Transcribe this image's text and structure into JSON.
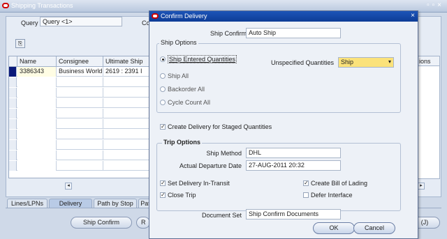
{
  "bg_window": {
    "title": "Shipping Transactions",
    "query_label": "Query",
    "query_value": "Query <1>",
    "co_text": "Co",
    "grid": {
      "headers": [
        "Name",
        "Consignee",
        "Ultimate Ship"
      ],
      "rows": [
        [
          "3386343",
          "Business World",
          "2619 : 2391 I"
        ]
      ],
      "right_header": "ions"
    },
    "tabs": [
      "Lines/LPNs",
      "Delivery",
      "Path by Stop",
      "Pat"
    ],
    "buttons": {
      "ship_confirm": "Ship Confirm",
      "r_button": "R",
      "j_button": "(J)"
    }
  },
  "dialog": {
    "title": "Confirm Delivery",
    "ship_confirm_rule_label": "Ship Confirm Rule",
    "ship_confirm_rule_value": "Auto Ship",
    "ship_options": {
      "title": "Ship Options",
      "radios": [
        {
          "label": "Ship Entered Quantities",
          "selected": true
        },
        {
          "label": "Ship All",
          "selected": false
        },
        {
          "label": "Backorder All",
          "selected": false
        },
        {
          "label": "Cycle Count All",
          "selected": false
        }
      ],
      "unspecified_label": "Unspecified Quantities",
      "unspecified_value": "Ship"
    },
    "create_delivery_staged": {
      "label": "Create Delivery for Staged Quantities",
      "checked": true
    },
    "trip_options": {
      "title": "Trip Options",
      "ship_method_label": "Ship Method",
      "ship_method_value": "DHL",
      "actual_departure_label": "Actual Departure Date",
      "actual_departure_value": "27-AUG-2011 20:32",
      "set_delivery_in_transit": {
        "label": "Set Delivery In-Transit",
        "checked": true
      },
      "close_trip": {
        "label": "Close Trip",
        "checked": true
      },
      "create_bill_of_lading": {
        "label": "Create Bill of Lading",
        "checked": true
      },
      "defer_interface": {
        "label": "Defer Interface",
        "checked": false
      }
    },
    "document_set_label": "Document Set",
    "document_set_value": "Ship Confirm Documents",
    "ok_label": "OK",
    "cancel_label": "Cancel"
  },
  "colors": {
    "dialog_title_bg": "#1d54b8",
    "dropdown_highlight": "#fbe27a",
    "active_row_marker": "#0b1a7a"
  }
}
